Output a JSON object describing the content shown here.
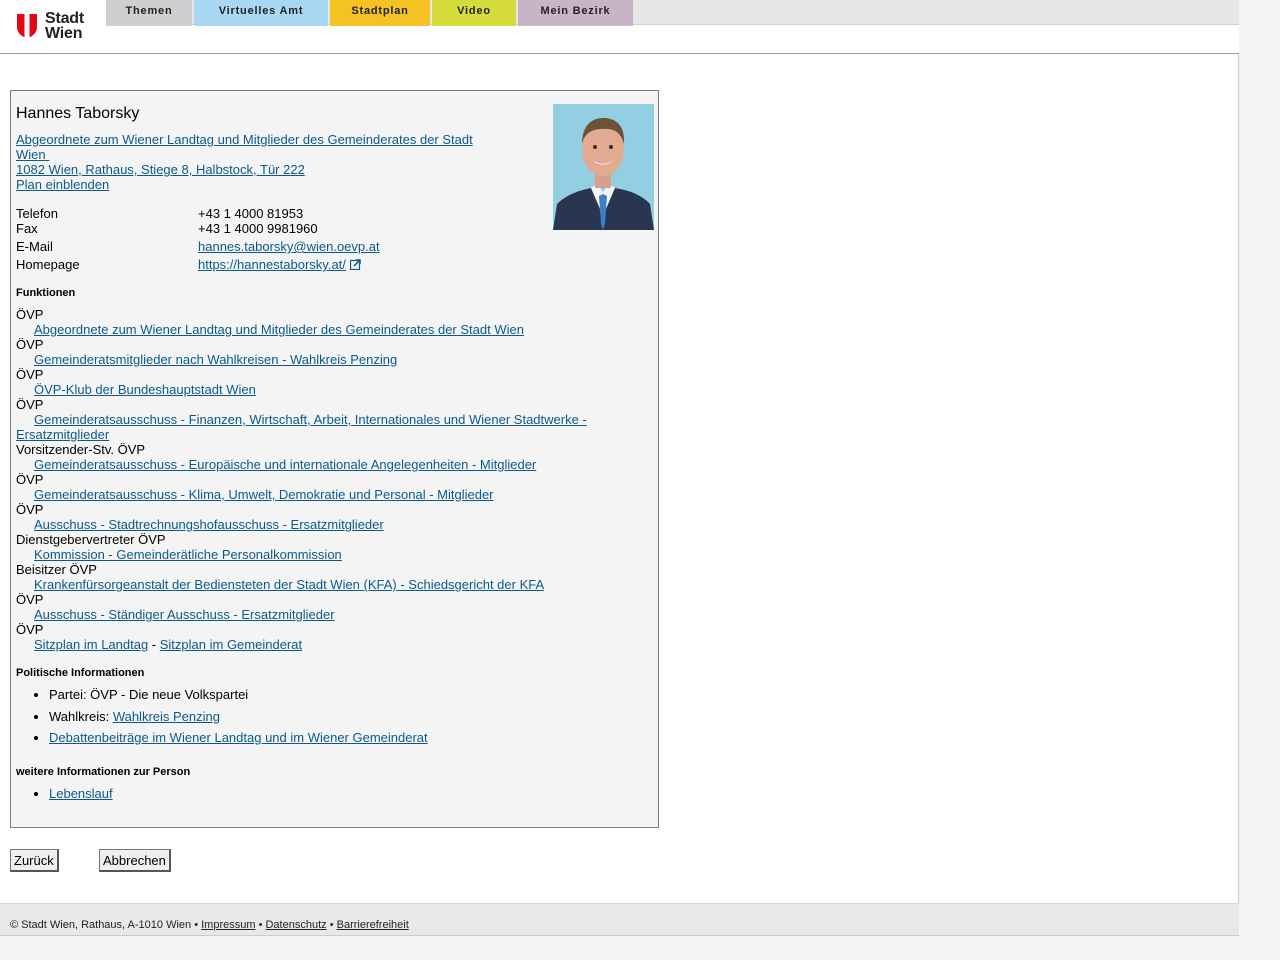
{
  "header": {
    "logo_line1": "Stadt",
    "logo_line2": "Wien",
    "tabs": [
      "Themen",
      "Virtuelles Amt",
      "Stadtplan",
      "Video",
      "Mein Bezirk"
    ]
  },
  "person": {
    "name": "Hannes Taborsky",
    "office_line1": "Abgeordnete zum Wiener Landtag und Mitglieder des Gemeinderates der Stadt",
    "office_line2": "Wien",
    "address": "1082 Wien, Rathaus, Stiege 8, Halbstock, Tür 222",
    "map_link": "Plan einblenden",
    "contact": [
      {
        "label": "Telefon",
        "value": "+43 1 4000 81953"
      },
      {
        "label": "Fax",
        "value": "+43 1 4000 9981960"
      },
      {
        "label": "E-Mail",
        "value": "hannes.taborsky@wien.oevp.at"
      },
      {
        "label": "Homepage",
        "value": "https://hannestaborsky.at/"
      }
    ]
  },
  "functions": {
    "title": "Funktionen",
    "items": [
      {
        "role": "ÖVP",
        "link": "Abgeordnete zum Wiener Landtag und Mitglieder des Gemeinderates der Stadt Wien"
      },
      {
        "role": "ÖVP",
        "link": "Gemeinderatsmitglieder nach Wahlkreisen - Wahlkreis Penzing"
      },
      {
        "role": "ÖVP",
        "link": "ÖVP-Klub der Bundeshauptstadt Wien"
      },
      {
        "role": "ÖVP",
        "link": "Gemeinderatsausschuss - Finanzen, Wirtschaft, Arbeit, Internationales und Wiener Stadtwerke - Ersatzmitglieder"
      },
      {
        "role": "Vorsitzender-Stv. ÖVP",
        "link": "Gemeinderatsausschuss - Europäische und internationale Angelegenheiten - Mitglieder"
      },
      {
        "role": "ÖVP",
        "link": "Gemeinderatsausschuss - Klima, Umwelt, Demokratie und Personal - Mitglieder"
      },
      {
        "role": "ÖVP",
        "link": "Ausschuss - Stadtrechnungshofausschuss - Ersatzmitglieder"
      },
      {
        "role": "Dienstgebervertreter ÖVP",
        "link": "Kommission - Gemeinderätliche Personalkommission"
      },
      {
        "role": "Beisitzer ÖVP",
        "link": "Krankenfürsorgeanstalt der Bediensteten der Stadt Wien (KFA) - Schiedsgericht der KFA"
      },
      {
        "role": "ÖVP",
        "link": "Ausschuss - Ständiger Ausschuss - Ersatzmitglieder"
      }
    ],
    "last_role": "ÖVP",
    "seat_landtag": "Sitzplan im Landtag",
    "seat_separator": " - ",
    "seat_gemeinderat": "Sitzplan im Gemeinderat"
  },
  "political": {
    "title": "Politische Informationen",
    "party": "Partei: ÖVP - Die neue Volkspartei",
    "district_prefix": "Wahlkreis: ",
    "district_link": "Wahlkreis Penzing",
    "debates": "Debattenbeiträge im Wiener Landtag und im Wiener Gemeinderat"
  },
  "further": {
    "title": "weitere Informationen zur Person",
    "cv": "Lebenslauf"
  },
  "buttons": {
    "back": "Zurück",
    "cancel": "Abbrechen"
  },
  "footer": {
    "copyright": "© Stadt Wien, Rathaus, A-1010 Wien • ",
    "impressum": "Impressum",
    "sep": " • ",
    "datenschutz": "Datenschutz",
    "barrierefreiheit": "Barrierefreiheit"
  }
}
